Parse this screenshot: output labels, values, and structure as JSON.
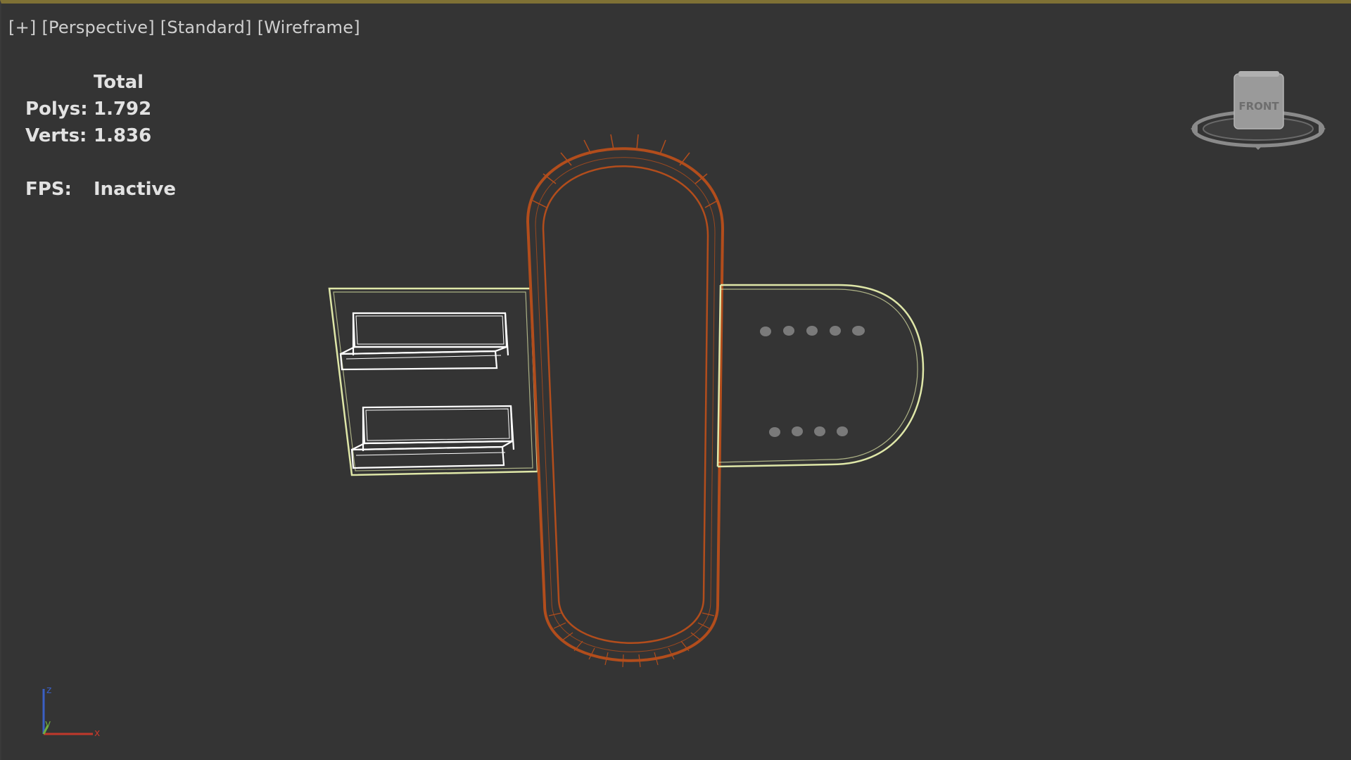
{
  "viewport": {
    "labels": [
      "[+]",
      "[Perspective]",
      "[Standard]",
      "[Wireframe]"
    ]
  },
  "stats": {
    "header": "Total",
    "polys_label": "Polys:",
    "polys_value": "1.792",
    "verts_label": "Verts:",
    "verts_value": "1.836",
    "fps_label": "FPS:",
    "fps_value": "Inactive"
  },
  "viewcube": {
    "face_label": "FRONT"
  },
  "axis": {
    "x": "x",
    "y": "y",
    "z": "z"
  },
  "colors": {
    "background": "#343434",
    "selected_outline": "#dfe7a8",
    "strap": "#b24d1c",
    "box_wire": "#ffffff",
    "holes": "#7a7a7a",
    "axis_x": "#c0392b",
    "axis_y": "#6fae3e",
    "axis_z": "#3a5fc4",
    "viewport_border": "#7f7135"
  }
}
